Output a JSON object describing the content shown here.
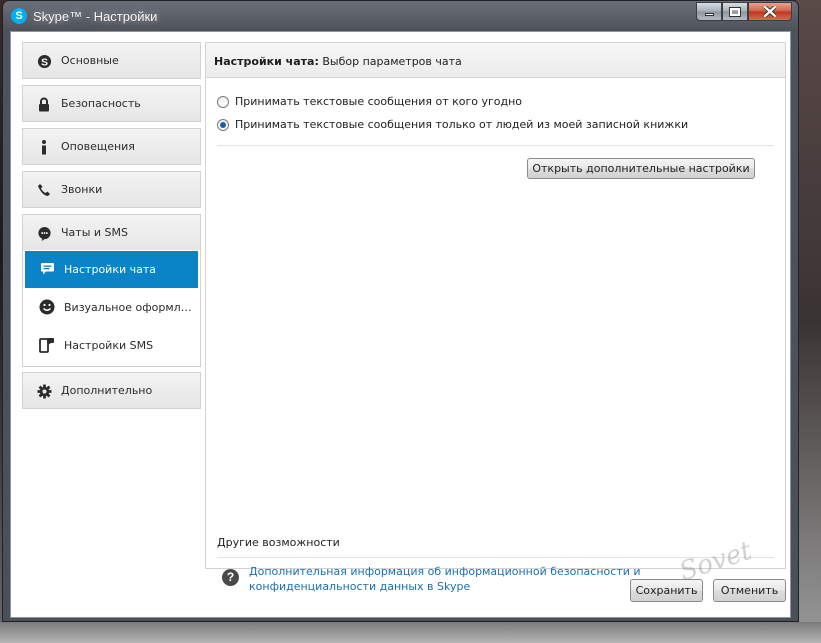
{
  "window": {
    "title": "Skype™ - Настройки",
    "app_icon_letter": "S"
  },
  "sidebar": {
    "items": [
      {
        "label": "Основные",
        "icon": "skype-icon"
      },
      {
        "label": "Безопасность",
        "icon": "lock-icon"
      },
      {
        "label": "Оповещения",
        "icon": "info-icon"
      },
      {
        "label": "Звонки",
        "icon": "phone-icon"
      },
      {
        "label": "Чаты и SMS",
        "icon": "chat-icon"
      },
      {
        "label": "Дополнительно",
        "icon": "gear-icon"
      }
    ],
    "sub_items": [
      {
        "label": "Настройки чата",
        "icon": "chat-bubble-icon",
        "active": true
      },
      {
        "label": "Визуальное оформле...",
        "icon": "smiley-icon",
        "active": false
      },
      {
        "label": "Настройки SMS",
        "icon": "sms-phone-icon",
        "active": false
      }
    ],
    "active_color": "#0a84c6"
  },
  "main": {
    "header_title": "Настройки чата:",
    "header_subtitle": "Выбор параметров чата",
    "radio_options": [
      {
        "label": "Принимать текстовые сообщения от кого угодно",
        "checked": false
      },
      {
        "label": "Принимать текстовые сообщения только от людей из моей записной книжки",
        "checked": true
      }
    ],
    "advanced_button": "Открыть дополнительные настройки",
    "other_title": "Другие возможности",
    "info_link": "Дополнительная информация об информационной безопасности и конфиденциальности данных в Skype",
    "link_color": "#1a6fb5"
  },
  "footer": {
    "save_label": "Сохранить",
    "cancel_label": "Отменить"
  },
  "watermark": "Sovet"
}
